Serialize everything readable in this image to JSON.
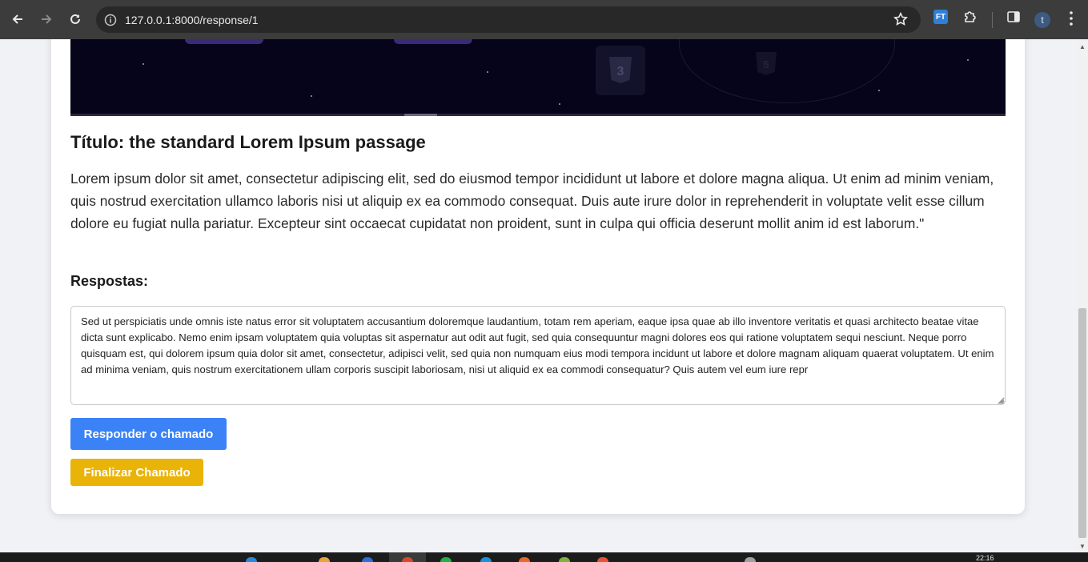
{
  "browser": {
    "url": "127.0.0.1:8000/response/1",
    "extension_badge": "FT",
    "profile_initial": "t",
    "icons": [
      "back-icon",
      "forward-icon",
      "reload-icon",
      "info-icon",
      "star-icon",
      "puzzle-icon",
      "side-panel-icon",
      "kebab-icon"
    ]
  },
  "page": {
    "title": "Título: the standard Lorem Ipsum passage",
    "description": "Lorem ipsum dolor sit amet, consectetur adipiscing elit, sed do eiusmod tempor incididunt ut labore et dolore magna aliqua. Ut enim ad minim veniam, quis nostrud exercitation ullamco laboris nisi ut aliquip ex ea commodo consequat. Duis aute irure dolor in reprehenderit in voluptate velit esse cillum dolore eu fugiat nulla pariatur. Excepteur sint occaecat cupidatat non proident, sunt in culpa qui officia deserunt mollit anim id est laborum.\"",
    "responses_label": "Respostas:",
    "response_text": "Sed ut perspiciatis unde omnis iste natus error sit voluptatem accusantium doloremque laudantium, totam rem aperiam, eaque ipsa quae ab illo inventore veritatis et quasi architecto beatae vitae dicta sunt explicabo. Nemo enim ipsam voluptatem quia voluptas sit aspernatur aut odit aut fugit, sed quia consequuntur magni dolores eos qui ratione voluptatem sequi nesciunt. Neque porro quisquam est, qui dolorem ipsum quia dolor sit amet, consectetur, adipisci velit, sed quia non numquam eius modi tempora incidunt ut labore et dolore magnam aliquam quaerat voluptatem. Ut enim ad minima veniam, quis nostrum exercitationem ullam corporis suscipit laboriosam, nisi ut aliquid ex ea commodi consequatur? Quis autem vel eum iure repr",
    "reply_button": "Responder o chamado",
    "finish_button": "Finalizar Chamado"
  },
  "colors": {
    "reply_button": "#3b82f6",
    "finish_button": "#eab308",
    "chrome_bar": "#3c3c3c",
    "banner_bg": "#05041a"
  },
  "taskbar": {
    "clock": "22:16"
  }
}
